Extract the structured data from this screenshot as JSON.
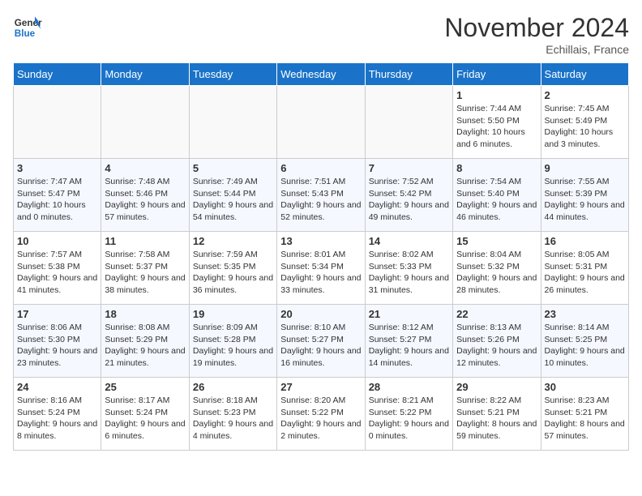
{
  "header": {
    "logo_line1": "General",
    "logo_line2": "Blue",
    "month": "November 2024",
    "location": "Echillais, France"
  },
  "weekdays": [
    "Sunday",
    "Monday",
    "Tuesday",
    "Wednesday",
    "Thursday",
    "Friday",
    "Saturday"
  ],
  "weeks": [
    [
      {
        "day": "",
        "info": ""
      },
      {
        "day": "",
        "info": ""
      },
      {
        "day": "",
        "info": ""
      },
      {
        "day": "",
        "info": ""
      },
      {
        "day": "",
        "info": ""
      },
      {
        "day": "1",
        "info": "Sunrise: 7:44 AM\nSunset: 5:50 PM\nDaylight: 10 hours and 6 minutes."
      },
      {
        "day": "2",
        "info": "Sunrise: 7:45 AM\nSunset: 5:49 PM\nDaylight: 10 hours and 3 minutes."
      }
    ],
    [
      {
        "day": "3",
        "info": "Sunrise: 7:47 AM\nSunset: 5:47 PM\nDaylight: 10 hours and 0 minutes."
      },
      {
        "day": "4",
        "info": "Sunrise: 7:48 AM\nSunset: 5:46 PM\nDaylight: 9 hours and 57 minutes."
      },
      {
        "day": "5",
        "info": "Sunrise: 7:49 AM\nSunset: 5:44 PM\nDaylight: 9 hours and 54 minutes."
      },
      {
        "day": "6",
        "info": "Sunrise: 7:51 AM\nSunset: 5:43 PM\nDaylight: 9 hours and 52 minutes."
      },
      {
        "day": "7",
        "info": "Sunrise: 7:52 AM\nSunset: 5:42 PM\nDaylight: 9 hours and 49 minutes."
      },
      {
        "day": "8",
        "info": "Sunrise: 7:54 AM\nSunset: 5:40 PM\nDaylight: 9 hours and 46 minutes."
      },
      {
        "day": "9",
        "info": "Sunrise: 7:55 AM\nSunset: 5:39 PM\nDaylight: 9 hours and 44 minutes."
      }
    ],
    [
      {
        "day": "10",
        "info": "Sunrise: 7:57 AM\nSunset: 5:38 PM\nDaylight: 9 hours and 41 minutes."
      },
      {
        "day": "11",
        "info": "Sunrise: 7:58 AM\nSunset: 5:37 PM\nDaylight: 9 hours and 38 minutes."
      },
      {
        "day": "12",
        "info": "Sunrise: 7:59 AM\nSunset: 5:35 PM\nDaylight: 9 hours and 36 minutes."
      },
      {
        "day": "13",
        "info": "Sunrise: 8:01 AM\nSunset: 5:34 PM\nDaylight: 9 hours and 33 minutes."
      },
      {
        "day": "14",
        "info": "Sunrise: 8:02 AM\nSunset: 5:33 PM\nDaylight: 9 hours and 31 minutes."
      },
      {
        "day": "15",
        "info": "Sunrise: 8:04 AM\nSunset: 5:32 PM\nDaylight: 9 hours and 28 minutes."
      },
      {
        "day": "16",
        "info": "Sunrise: 8:05 AM\nSunset: 5:31 PM\nDaylight: 9 hours and 26 minutes."
      }
    ],
    [
      {
        "day": "17",
        "info": "Sunrise: 8:06 AM\nSunset: 5:30 PM\nDaylight: 9 hours and 23 minutes."
      },
      {
        "day": "18",
        "info": "Sunrise: 8:08 AM\nSunset: 5:29 PM\nDaylight: 9 hours and 21 minutes."
      },
      {
        "day": "19",
        "info": "Sunrise: 8:09 AM\nSunset: 5:28 PM\nDaylight: 9 hours and 19 minutes."
      },
      {
        "day": "20",
        "info": "Sunrise: 8:10 AM\nSunset: 5:27 PM\nDaylight: 9 hours and 16 minutes."
      },
      {
        "day": "21",
        "info": "Sunrise: 8:12 AM\nSunset: 5:27 PM\nDaylight: 9 hours and 14 minutes."
      },
      {
        "day": "22",
        "info": "Sunrise: 8:13 AM\nSunset: 5:26 PM\nDaylight: 9 hours and 12 minutes."
      },
      {
        "day": "23",
        "info": "Sunrise: 8:14 AM\nSunset: 5:25 PM\nDaylight: 9 hours and 10 minutes."
      }
    ],
    [
      {
        "day": "24",
        "info": "Sunrise: 8:16 AM\nSunset: 5:24 PM\nDaylight: 9 hours and 8 minutes."
      },
      {
        "day": "25",
        "info": "Sunrise: 8:17 AM\nSunset: 5:24 PM\nDaylight: 9 hours and 6 minutes."
      },
      {
        "day": "26",
        "info": "Sunrise: 8:18 AM\nSunset: 5:23 PM\nDaylight: 9 hours and 4 minutes."
      },
      {
        "day": "27",
        "info": "Sunrise: 8:20 AM\nSunset: 5:22 PM\nDaylight: 9 hours and 2 minutes."
      },
      {
        "day": "28",
        "info": "Sunrise: 8:21 AM\nSunset: 5:22 PM\nDaylight: 9 hours and 0 minutes."
      },
      {
        "day": "29",
        "info": "Sunrise: 8:22 AM\nSunset: 5:21 PM\nDaylight: 8 hours and 59 minutes."
      },
      {
        "day": "30",
        "info": "Sunrise: 8:23 AM\nSunset: 5:21 PM\nDaylight: 8 hours and 57 minutes."
      }
    ]
  ]
}
